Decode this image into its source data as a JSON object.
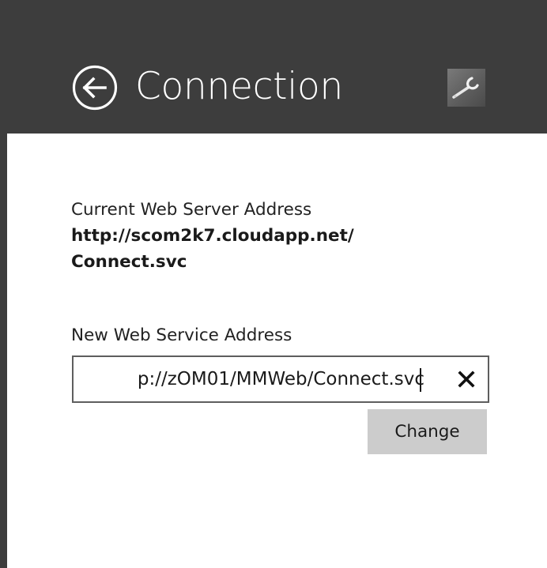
{
  "header": {
    "title": "Connection",
    "back_icon": "back-arrow-circle-icon",
    "logo_icon": "wrench-icon"
  },
  "current": {
    "label": "Current Web Server Address",
    "value_line1": "http://scom2k7.cloudapp.net/",
    "value_line2": "Connect.svc"
  },
  "new_address": {
    "label": "New Web Service Address",
    "value": "p://zOM01/MMWeb/Connect.svc",
    "clear_icon": "close-icon"
  },
  "change_button": {
    "label": "Change"
  },
  "colors": {
    "header_background": "#3d3d3d",
    "page_background": "#ffffff",
    "button_background": "#cccccc",
    "input_border": "#5e5e5e"
  }
}
